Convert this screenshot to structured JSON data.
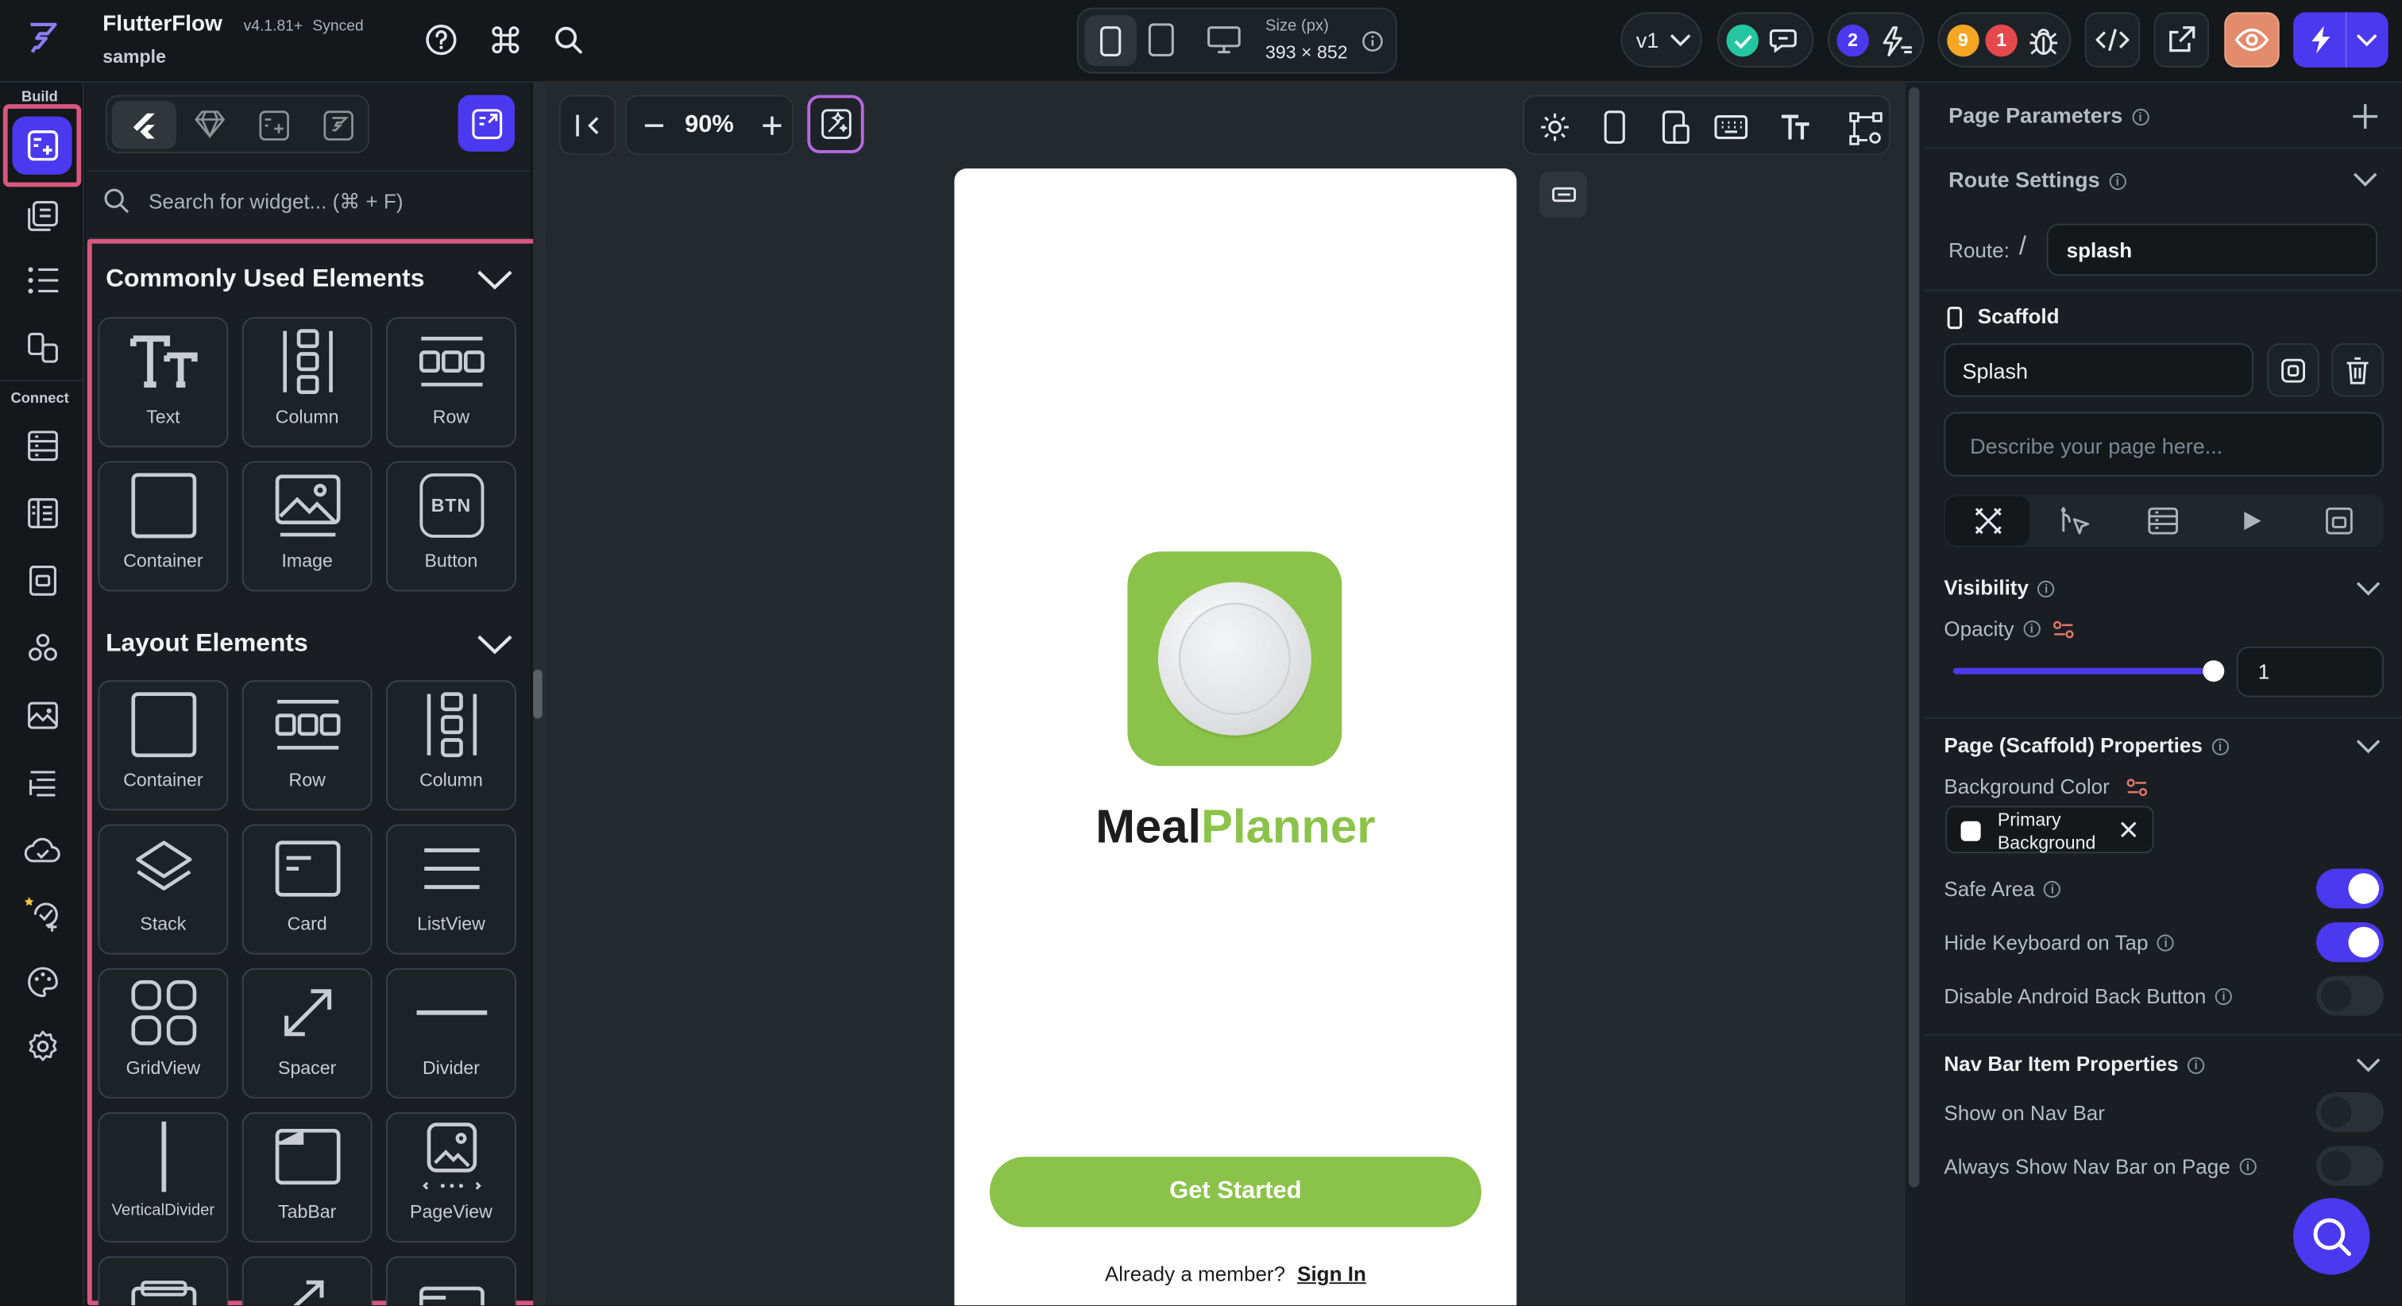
{
  "app": {
    "name": "FlutterFlow",
    "version": "v4.1.81+",
    "sync_status": "Synced",
    "project": "sample"
  },
  "toolbar": {
    "size_label": "Size (px)",
    "size_value": "393 × 852",
    "version_select": "v1",
    "collab_count": "2",
    "warnings_count": "9",
    "errors_count": "1"
  },
  "rail": {
    "build_label": "Build",
    "connect_label": "Connect"
  },
  "widget_panel": {
    "search_placeholder": "Search for widget... (⌘ + F)",
    "common_title": "Commonly Used Elements",
    "common_items": [
      "Text",
      "Column",
      "Row",
      "Container",
      "Image",
      "Button"
    ],
    "layout_title": "Layout Elements",
    "layout_items": [
      "Container",
      "Row",
      "Column",
      "Stack",
      "Card",
      "ListView",
      "GridView",
      "Spacer",
      "Divider",
      "VerticalDivider",
      "TabBar",
      "PageView"
    ],
    "button_icon_text": "BTN"
  },
  "canvas": {
    "zoom": "90%"
  },
  "preview": {
    "title_part1": "Meal",
    "title_part2": "Planner",
    "cta_label": "Get Started",
    "footer_text": "Already a member?",
    "signin_label": "Sign In"
  },
  "props": {
    "page_parameters": "Page Parameters",
    "route_settings": "Route Settings",
    "route_label": "Route:",
    "route_slash": "/",
    "route_value": "splash",
    "scaffold_label": "Scaffold",
    "page_name": "Splash",
    "description_placeholder": "Describe your page here...",
    "visibility": "Visibility",
    "opacity_label": "Opacity",
    "opacity_value": "1",
    "opacity": 1,
    "scaffold_props": "Page (Scaffold) Properties",
    "bg_color_label": "Background Color",
    "bg_color_value_line1": "Primary",
    "bg_color_value_line2": "Background",
    "safe_area": "Safe Area",
    "safe_area_on": true,
    "hide_keyboard": "Hide Keyboard on Tap",
    "hide_keyboard_on": true,
    "disable_back": "Disable Android Back Button",
    "disable_back_on": false,
    "navbar_props": "Nav Bar Item Properties",
    "show_on_navbar": "Show on Nav Bar",
    "show_on_navbar_on": false,
    "always_show_navbar": "Always Show Nav Bar on Page",
    "always_show_navbar_on": false
  },
  "colors": {
    "accent": "#4b39ef",
    "brand_green": "#8bc34a",
    "highlight": "#d9577f",
    "success": "#24c6a0",
    "warning": "#f5a623",
    "error": "#e5484d"
  }
}
